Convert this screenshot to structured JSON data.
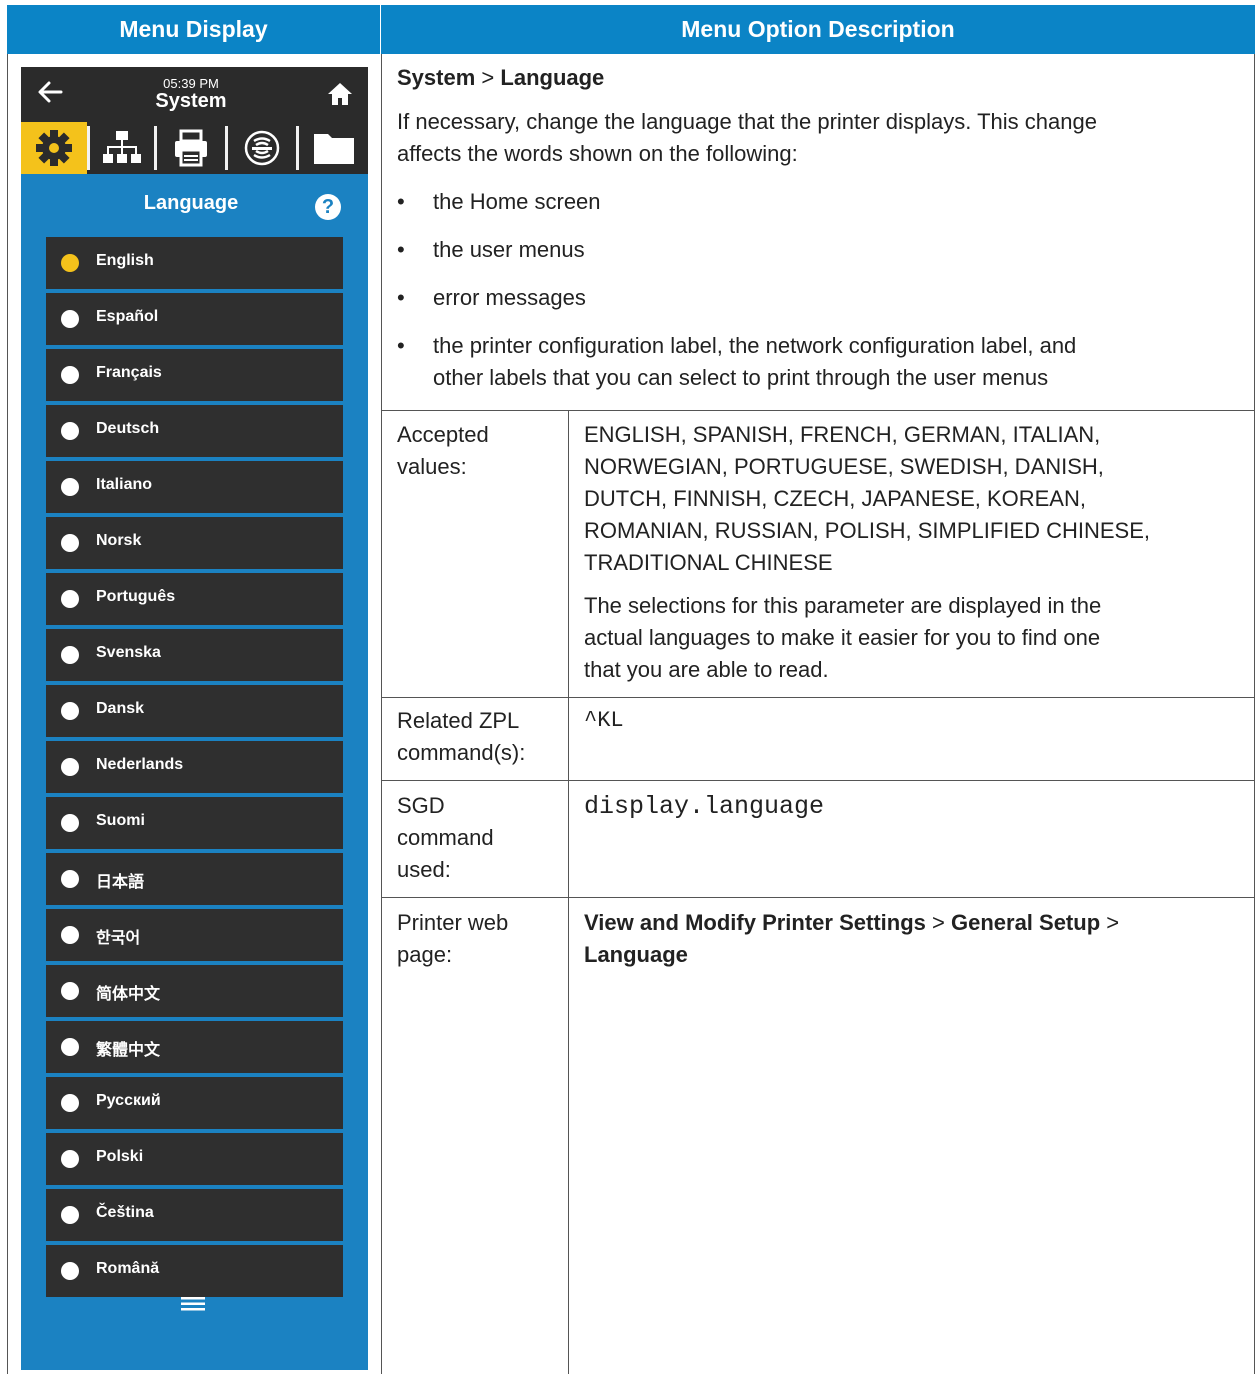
{
  "headers": {
    "menu_display": "Menu Display",
    "menu_option_description": "Menu Option Description"
  },
  "device": {
    "time": "05:39 PM",
    "title": "System",
    "tabs": [
      "gear-icon",
      "network-icon",
      "printer-icon",
      "rfid-icon",
      "folder-icon"
    ],
    "active_tab": 0,
    "panel_title": "Language",
    "help": "?",
    "languages": [
      {
        "label": "English",
        "selected": true
      },
      {
        "label": "Español",
        "selected": false
      },
      {
        "label": "Français",
        "selected": false
      },
      {
        "label": "Deutsch",
        "selected": false
      },
      {
        "label": "Italiano",
        "selected": false
      },
      {
        "label": "Norsk",
        "selected": false
      },
      {
        "label": "Português",
        "selected": false
      },
      {
        "label": "Svenska",
        "selected": false
      },
      {
        "label": "Dansk",
        "selected": false
      },
      {
        "label": "Nederlands",
        "selected": false
      },
      {
        "label": "Suomi",
        "selected": false
      },
      {
        "label": "日本語",
        "selected": false
      },
      {
        "label": "한국어",
        "selected": false
      },
      {
        "label": "简体中文",
        "selected": false
      },
      {
        "label": "繁體中文",
        "selected": false
      },
      {
        "label": "Русский",
        "selected": false
      },
      {
        "label": "Polski",
        "selected": false
      },
      {
        "label": "Čeština",
        "selected": false
      },
      {
        "label": "Română",
        "selected": false
      }
    ]
  },
  "description": {
    "path_system": "System",
    "path_sep": ">",
    "path_language": "Language",
    "intro_line1": "If necessary, change the language that the printer displays. This change",
    "intro_line2": "affects the words shown on the following:",
    "bullets": [
      "the Home screen",
      "the user menus",
      "error messages"
    ],
    "bullet4_line1": "the printer configuration label, the network configuration label, and",
    "bullet4_line2": "other labels that you can select to print through the user menus"
  },
  "rows": {
    "accepted_label_1": "Accepted",
    "accepted_label_2": "values:",
    "accepted_values": [
      "ENGLISH, SPANISH, FRENCH, GERMAN, ITALIAN,",
      "NORWEGIAN, PORTUGUESE, SWEDISH, DANISH,",
      "DUTCH, FINNISH, CZECH, JAPANESE, KOREAN,",
      "ROMANIAN, RUSSIAN, POLISH, SIMPLIFIED CHINESE,",
      "TRADITIONAL CHINESE"
    ],
    "accepted_note": [
      "The selections for this parameter are displayed in the",
      "actual languages to make it easier for you to find one",
      "that you are able to read."
    ],
    "zpl_label_1": "Related ZPL",
    "zpl_label_2": "command(s):",
    "zpl_value": "^KL",
    "sgd_label_1": "SGD",
    "sgd_label_2": "command",
    "sgd_label_3": "used:",
    "sgd_value": "display.language",
    "web_label_1": "Printer web",
    "web_label_2": "page:",
    "web_part1": "View and Modify Printer Settings",
    "web_sep1": ">",
    "web_part2": "General Setup",
    "web_sep2": ">",
    "web_part3": "Language"
  }
}
